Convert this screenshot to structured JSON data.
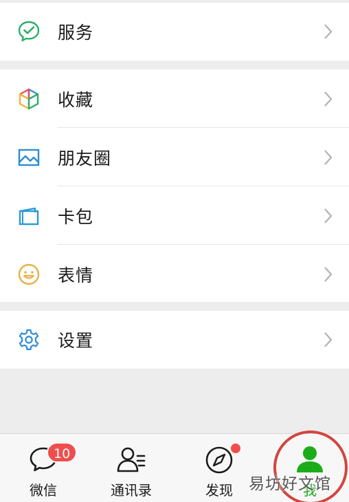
{
  "menu": {
    "services": {
      "label": "服务",
      "icon": "wechat-pay-icon",
      "color": "#2aae67"
    },
    "favorites": {
      "label": "收藏",
      "icon": "cube-icon"
    },
    "moments": {
      "label": "朋友圈",
      "icon": "image-icon",
      "color": "#2d8cd6"
    },
    "cards": {
      "label": "卡包",
      "icon": "card-wallet-icon",
      "color": "#2a9ad6"
    },
    "stickers": {
      "label": "表情",
      "icon": "smiley-icon",
      "color": "#e8b046"
    },
    "settings": {
      "label": "设置",
      "icon": "gear-icon",
      "color": "#2d8cd6"
    }
  },
  "tabbar": {
    "chats": {
      "label": "微信",
      "badge": "10"
    },
    "contacts": {
      "label": "通讯录"
    },
    "discover": {
      "label": "发现"
    },
    "me": {
      "label": "我",
      "active_color": "#1aad19"
    }
  },
  "watermark": "易坊好文馆"
}
